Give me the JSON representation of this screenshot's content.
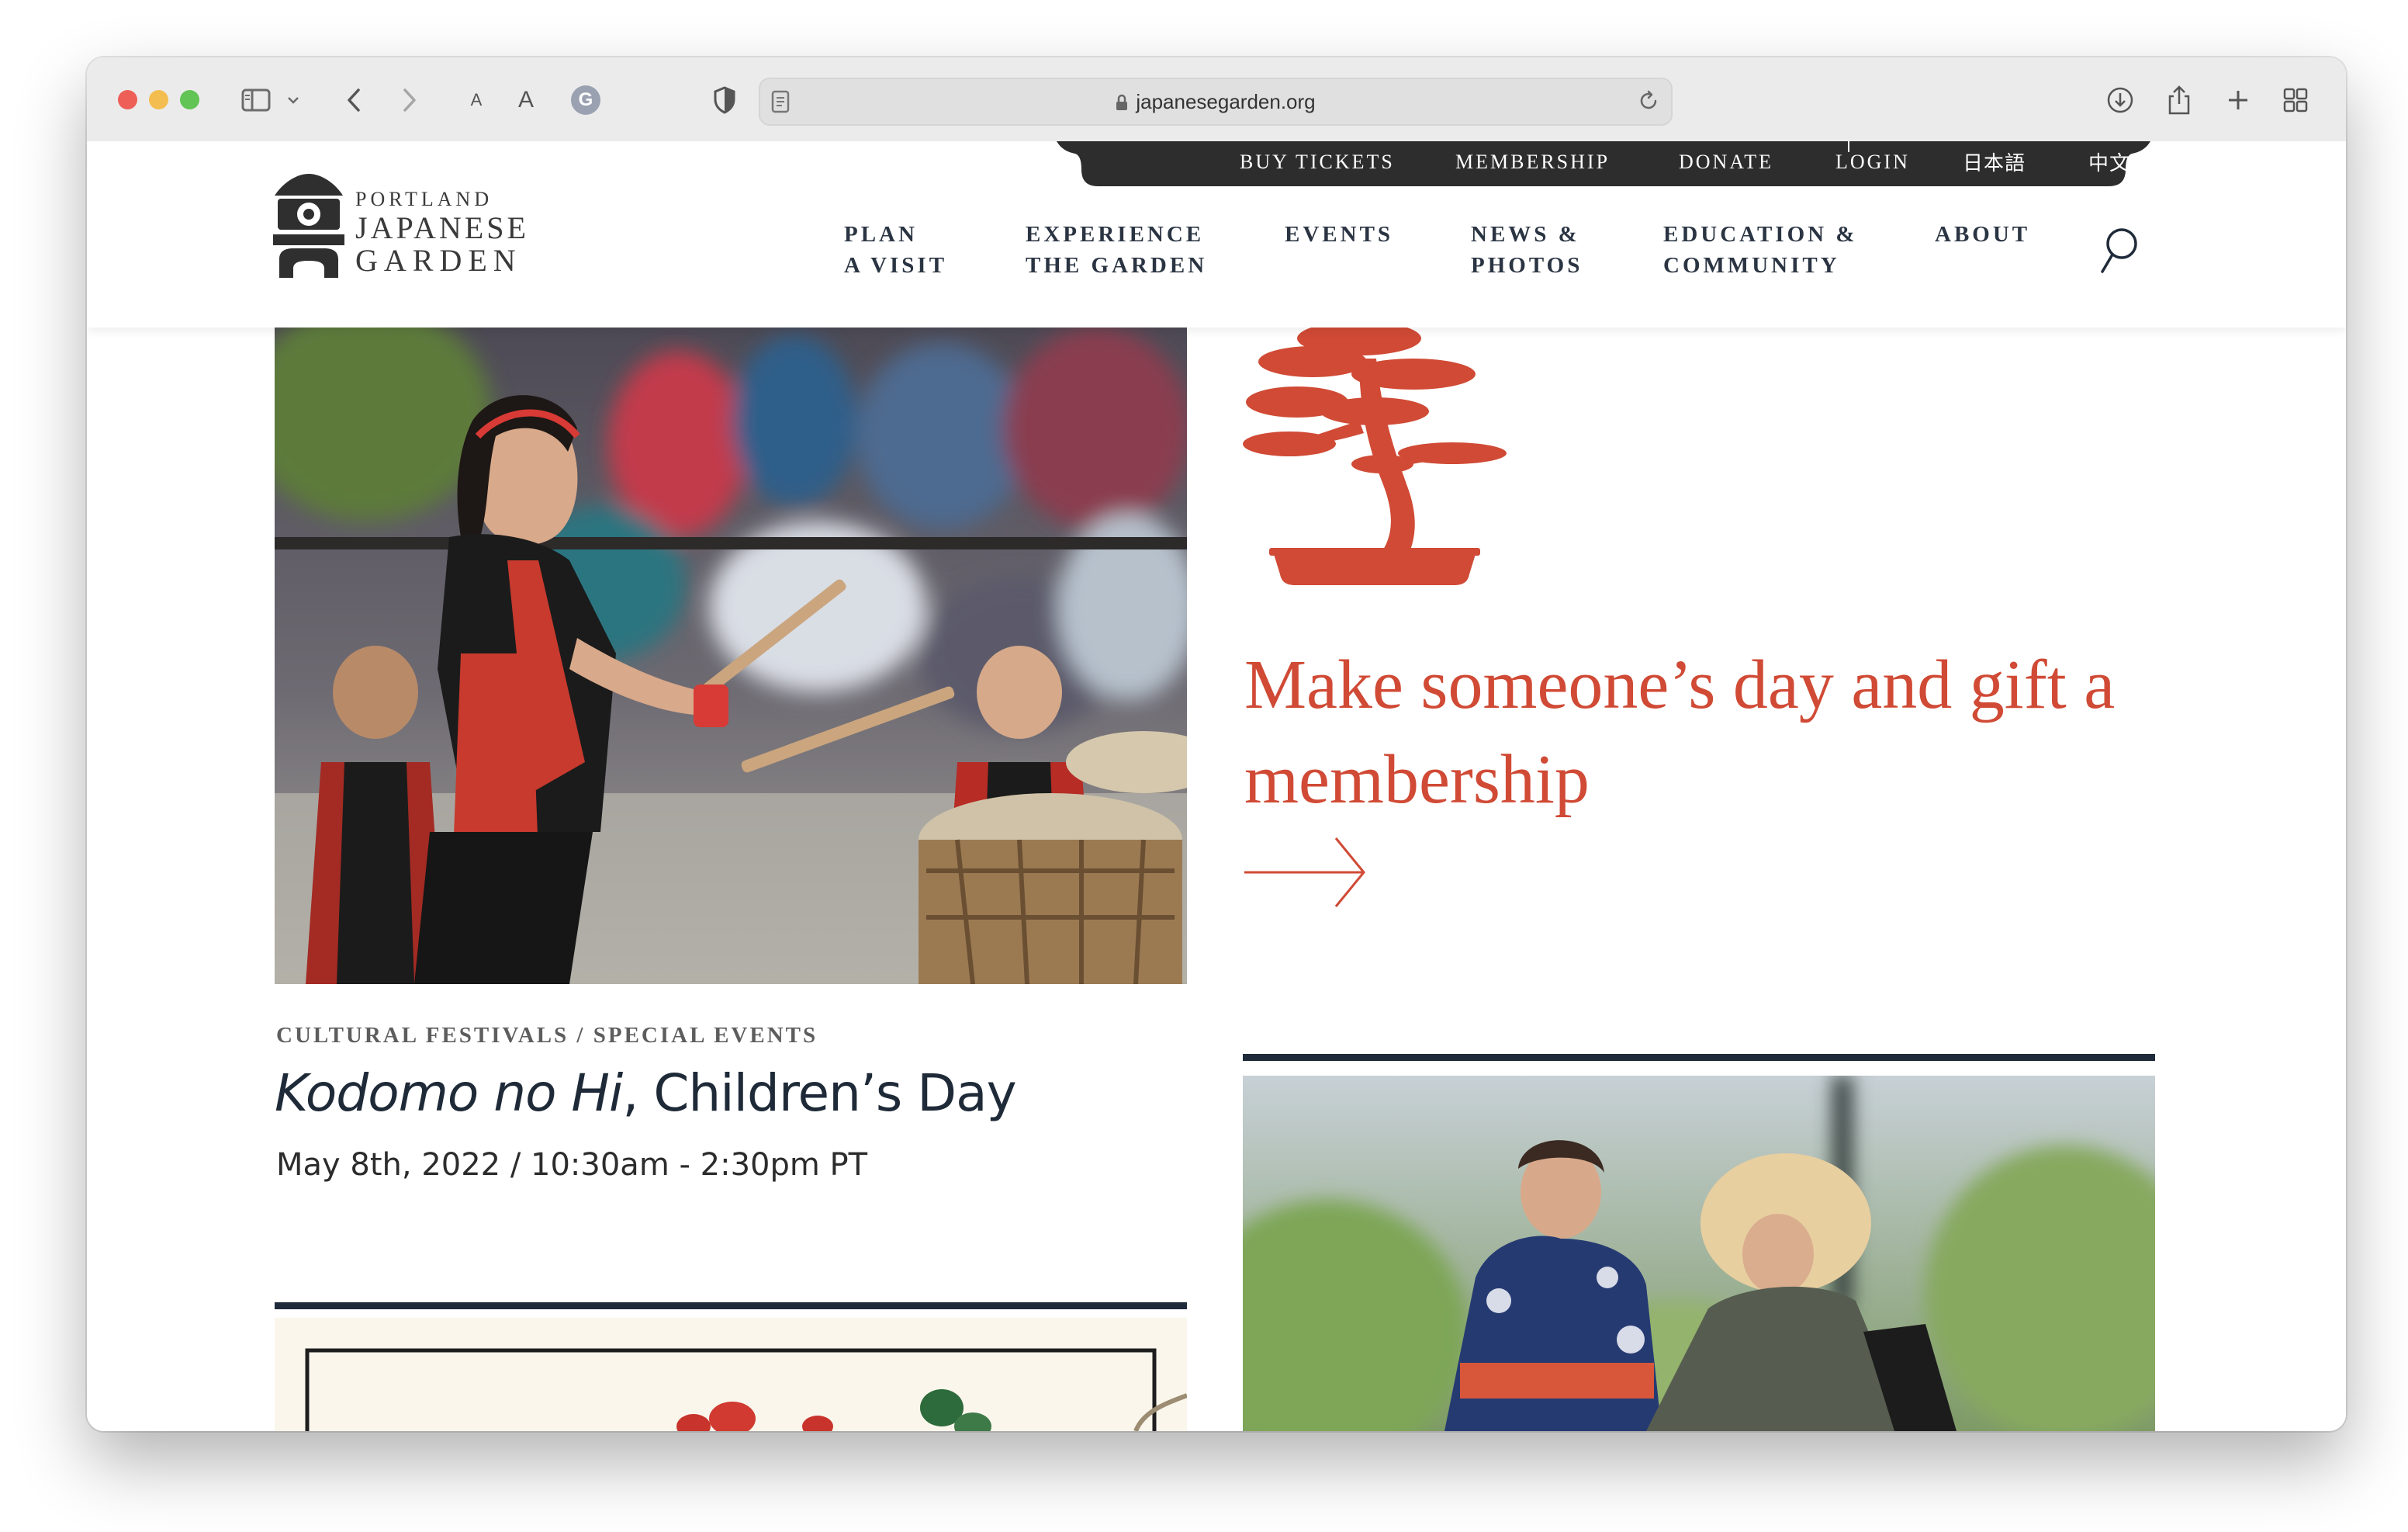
{
  "browser": {
    "url": "japanesegarden.org",
    "icons": [
      "sidebar-icon",
      "chevron-down-icon",
      "back-icon",
      "forward-icon",
      "text-size-small-icon",
      "text-size-large-icon",
      "grammarly-icon",
      "shield-icon",
      "reader-icon",
      "lock-icon",
      "reload-icon",
      "download-icon",
      "share-icon",
      "new-tab-icon",
      "tab-overview-icon"
    ],
    "text_small": "A",
    "text_large": "A",
    "extension_letter": "G"
  },
  "site": {
    "logo": {
      "line1": "PORTLAND",
      "line2": "JAPANESE",
      "line3": "GARDEN"
    },
    "utility_nav": [
      "BUY TICKETS",
      "MEMBERSHIP",
      "DONATE",
      "LOGIN",
      "日本語",
      "中文"
    ],
    "main_nav": [
      {
        "line1": "PLAN",
        "line2": "A VISIT"
      },
      {
        "line1": "EXPERIENCE",
        "line2": "THE GARDEN"
      },
      {
        "line1": "EVENTS",
        "line2": ""
      },
      {
        "line1": "NEWS &",
        "line2": "PHOTOS"
      },
      {
        "line1": "EDUCATION &",
        "line2": "COMMUNITY"
      },
      {
        "line1": "ABOUT",
        "line2": ""
      }
    ],
    "colors": {
      "navy": "#1f2b3a",
      "accent_red": "#d04a35",
      "util_bar": "#2d2d2d"
    }
  },
  "event": {
    "category": "CULTURAL FESTIVALS / SPECIAL EVENTS",
    "title_italic": "Kodomo no Hi",
    "title_rest": ", Children’s Day",
    "date": "May 8th, 2022 / 10:30am - 2:30pm PT"
  },
  "promo": {
    "headline": "Make someone’s day and gift a membership"
  }
}
